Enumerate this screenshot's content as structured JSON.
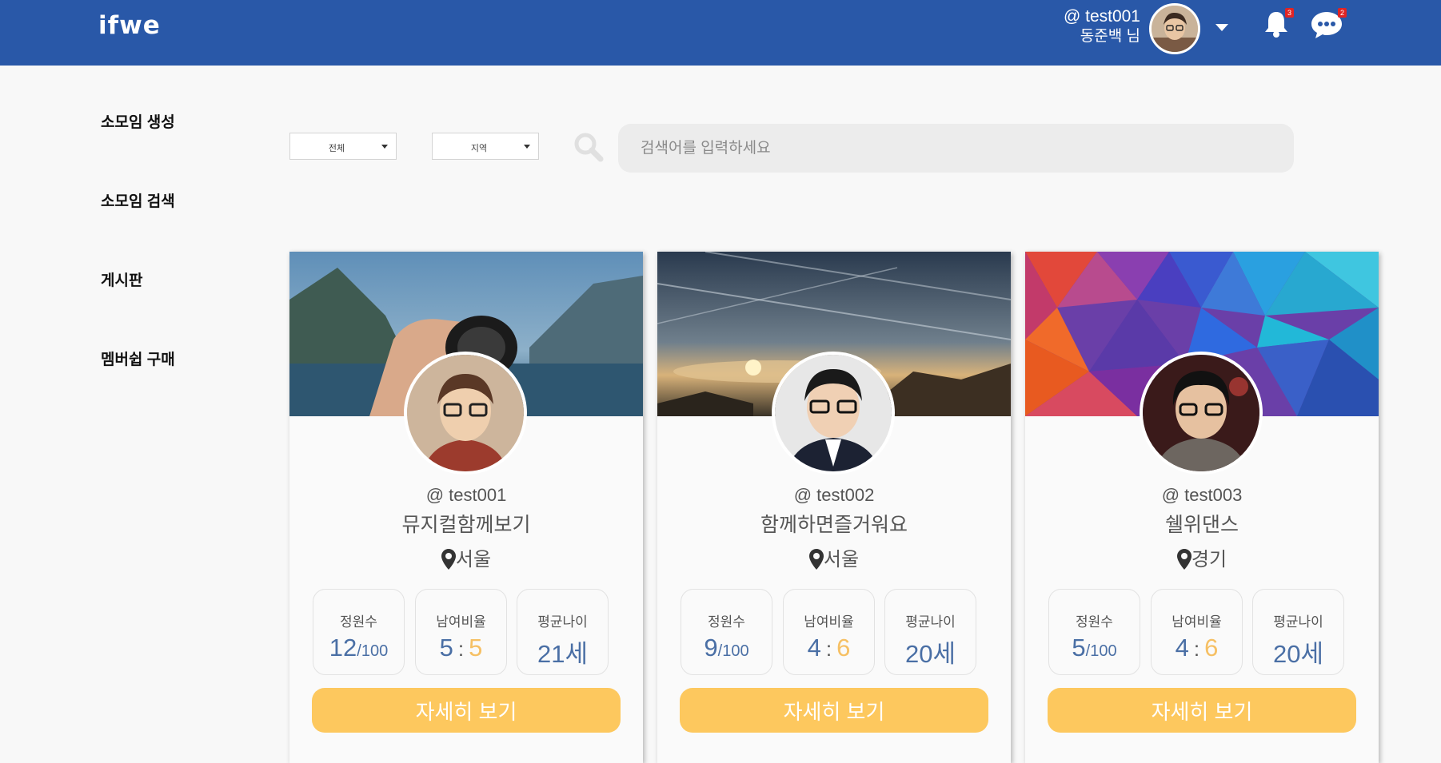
{
  "header": {
    "logo": "ifwe",
    "user_id": "@ test001",
    "user_nickname": "동준백 님",
    "notification_count": "3",
    "message_count": "2",
    "brand_color": "#2958a8"
  },
  "sidebar": {
    "items": [
      {
        "label": "소모임 생성"
      },
      {
        "label": "소모임 검색"
      },
      {
        "label": "게시판"
      },
      {
        "label": "멤버쉽 구매"
      }
    ]
  },
  "filters": {
    "category": "전체",
    "region": "지역",
    "search_placeholder": "검색어를 입력하세요"
  },
  "cards": [
    {
      "user": "@ test001",
      "title": "뮤지컬함께보기",
      "location": "서울",
      "members": "12",
      "capacity": "/100",
      "male": "5",
      "female": "5",
      "avg_age": "21세",
      "labels": {
        "members": "정원수",
        "ratio": "남여비율",
        "age": "평균나이"
      },
      "button": "자세히 보기"
    },
    {
      "user": "@ test002",
      "title": "함께하면즐거워요",
      "location": "서울",
      "members": "9",
      "capacity": "/100",
      "male": "4",
      "female": "6",
      "avg_age": "20세",
      "labels": {
        "members": "정원수",
        "ratio": "남여비율",
        "age": "평균나이"
      },
      "button": "자세히 보기"
    },
    {
      "user": "@ test003",
      "title": "쉘위댄스",
      "location": "경기",
      "members": "5",
      "capacity": "/100",
      "male": "4",
      "female": "6",
      "avg_age": "20세",
      "labels": {
        "members": "정원수",
        "ratio": "남여비율",
        "age": "평균나이"
      },
      "button": "자세히 보기"
    }
  ],
  "colors": {
    "button": "#fdc85e",
    "male_value": "#4a6fa5",
    "female_value": "#f6c064"
  }
}
